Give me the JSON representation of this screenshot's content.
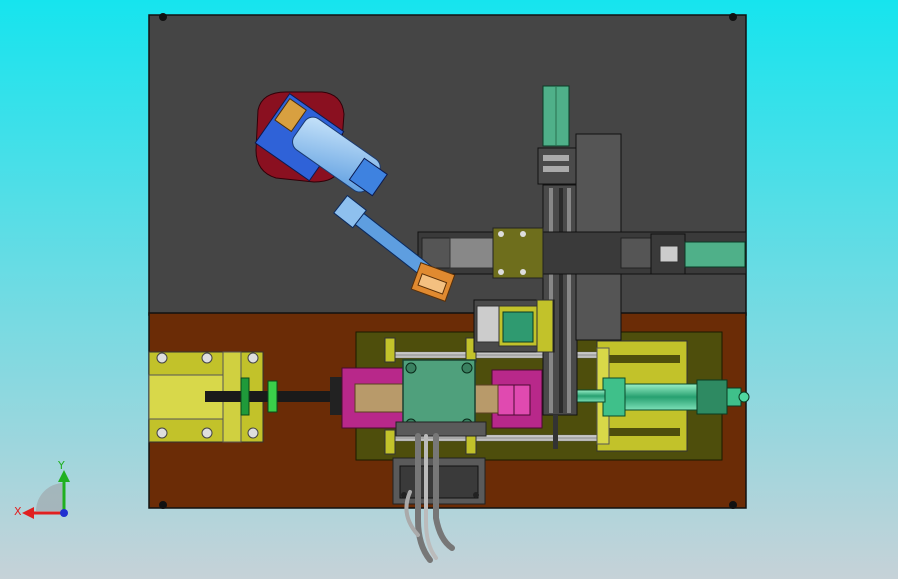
{
  "view": {
    "kind": "CAD assembly model, top view",
    "background_top": "#16e4ee",
    "background_bottom": "#c6d2d8"
  },
  "triad": {
    "x_label": "X",
    "y_label": "Y",
    "x_color": "#e02020",
    "y_color": "#20b020",
    "z_color": "#2030d0"
  },
  "palette": {
    "plate_gray": "#454545",
    "plate_brown": "#6b2c06",
    "olive": "#c2c22a",
    "dark_olive": "#4e4e0c",
    "magenta": "#b8288a",
    "tan": "#b89a6a",
    "green_block": "#4fa07c",
    "teal_rail": "#4fb089",
    "robot_blue": "#2f62d8",
    "robot_light": "#8ec0ee",
    "robot_base": "#8a1020",
    "gripper_orange": "#e08a30"
  }
}
